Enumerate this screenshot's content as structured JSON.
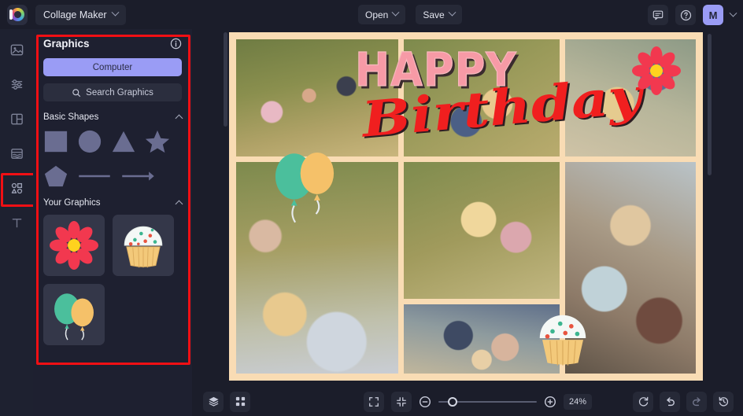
{
  "header": {
    "logo_icon": "color-wheel-logo",
    "app_title": "Collage Maker",
    "open_label": "Open",
    "save_label": "Save",
    "chat_icon": "chat-icon",
    "help_icon": "help-circle-icon",
    "avatar_initial": "M"
  },
  "rail": {
    "items": [
      {
        "icon": "image-icon",
        "name": "image"
      },
      {
        "icon": "adjustments-icon",
        "name": "adjust"
      },
      {
        "icon": "layout-icon",
        "name": "layout"
      },
      {
        "icon": "templates-icon",
        "name": "templates"
      },
      {
        "icon": "graphics-icon",
        "name": "graphics"
      },
      {
        "icon": "text-icon",
        "name": "text"
      }
    ]
  },
  "panel": {
    "title": "Graphics",
    "info_icon": "info-icon",
    "computer_label": "Computer",
    "search_icon": "search-icon",
    "search_placeholder": "Search Graphics",
    "basic_shapes": {
      "title": "Basic Shapes",
      "collapse_icon": "chevron-up-icon",
      "shapes": [
        "square",
        "circle",
        "triangle",
        "star",
        "pentagon",
        "line",
        "arrow"
      ]
    },
    "your_graphics": {
      "title": "Your Graphics",
      "collapse_icon": "chevron-up-icon",
      "items": [
        "flower",
        "cupcake",
        "balloons"
      ]
    }
  },
  "canvas": {
    "collage_title_top": "HAPPY",
    "collage_title_bottom": "Birthday",
    "border_color": "#f9dcb4",
    "stickers": [
      "flower",
      "balloons",
      "cupcake"
    ],
    "cells": [
      {
        "name": "photo-group-picnic"
      },
      {
        "name": "photo-center-top"
      },
      {
        "name": "photo-top-right"
      },
      {
        "name": "photo-left-tall"
      },
      {
        "name": "photo-two-friends"
      },
      {
        "name": "photo-right-tall"
      },
      {
        "name": "photo-sunglasses-trio"
      }
    ]
  },
  "bottombar": {
    "layers_icon": "layers-icon",
    "grid_icon": "grid-icon",
    "fullscreen_icon": "fullscreen-icon",
    "fit_icon": "fit-screen-icon",
    "zoom_out_icon": "zoom-out-icon",
    "zoom_in_icon": "zoom-in-icon",
    "zoom_value": "24%",
    "reset_icon": "reset-icon",
    "undo_icon": "undo-icon",
    "redo_icon": "redo-icon",
    "history_icon": "history-icon"
  },
  "colors": {
    "accent": "#9a9cf5",
    "annotation": "#f10f14",
    "shape_fill": "#6a6d91",
    "collage_border": "#f9dcb4"
  }
}
